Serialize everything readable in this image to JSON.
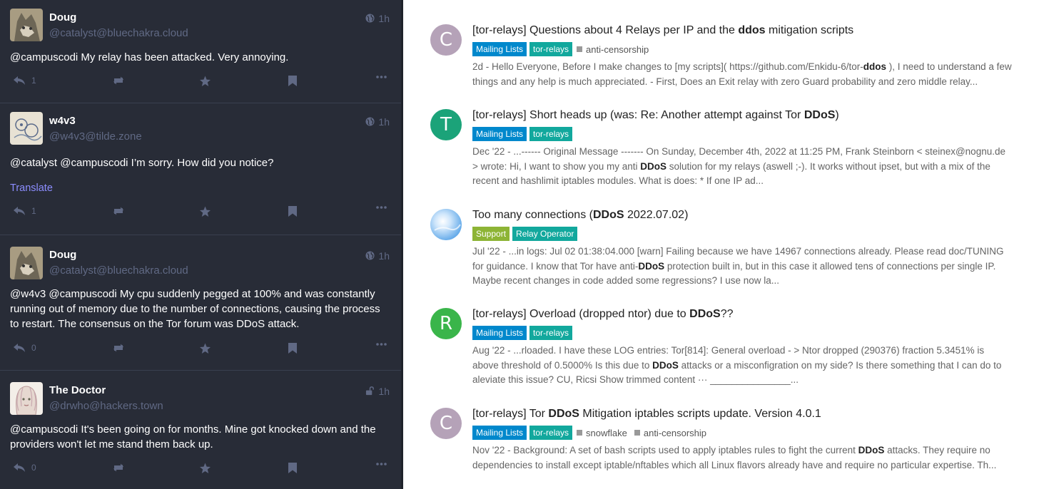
{
  "feed": {
    "posts": [
      {
        "name": "Doug",
        "handle": "@catalyst@bluechakra.cloud",
        "time": "1h",
        "content": "@campuscodi My relay has been attacked. Very annoying.",
        "replies": "1",
        "translate": ""
      },
      {
        "name": "w4v3",
        "handle": "@w4v3@tilde.zone",
        "time": "1h",
        "content": "@catalyst @campuscodi I’m sorry. How did you notice?",
        "replies": "1",
        "translate": "Translate"
      },
      {
        "name": "Doug",
        "handle": "@catalyst@bluechakra.cloud",
        "time": "1h",
        "content": "@w4v3 @campuscodi My cpu suddenly pegged at 100% and was constantly running out of memory due to the number of connections, causing the process to restart. The consensus on the Tor forum was DDoS attack.",
        "replies": "0",
        "translate": ""
      },
      {
        "name": "The Doctor",
        "handle": "@drwho@hackers.town",
        "time": "1h",
        "content": "@campuscodi It's been going on for months. Mine got knocked down and the providers won't let me stand them back up.",
        "replies": "0",
        "translate": ""
      }
    ]
  },
  "results": {
    "topics": [
      {
        "letter": "C",
        "avatar_color": "#b5a2b8",
        "title_pre": "[tor-relays] Questions about 4 Relays per IP and the ",
        "title_bold": "ddos",
        "title_post": " mitigation scripts",
        "badges": [
          {
            "label": "Mailing Lists",
            "color": "#0088cc"
          },
          {
            "label": "tor-relays",
            "color": "#12a89d"
          }
        ],
        "tags": [
          "anti-censorship"
        ],
        "when": "2d",
        "excerpt_a": " - Hello Everyone, Before I make changes to [my scripts]( https://github.com/Enkidu-6/tor-",
        "excerpt_bold": "ddos",
        "excerpt_b": " ), I need to understand a few things and any help is much appreciated. - First, Does an Exit relay with zero Guard probability and zero middle relay..."
      },
      {
        "letter": "T",
        "avatar_color": "#1ba379",
        "title_pre": "[tor-relays] Short heads up (was: Re: Another attempt against Tor ",
        "title_bold": "DDoS",
        "title_post": ")",
        "badges": [
          {
            "label": "Mailing Lists",
            "color": "#0088cc"
          },
          {
            "label": "tor-relays",
            "color": "#12a89d"
          }
        ],
        "tags": [],
        "when": "Dec '22",
        "excerpt_a": " - ...------ Original Message ------- On Sunday, December 4th, 2022 at 11:25 PM, Frank Steinborn < steinex@nognu.de > wrote: Hi, I want to show you my anti ",
        "excerpt_bold": "DDoS",
        "excerpt_b": " solution for my relays (aswell ;-). It works without ipset, but with a mix of the recent and hashlimit iptables modules. What is does: * If one IP ad..."
      },
      {
        "letter": "",
        "avatar_color": "#8fc4ef",
        "title_pre": "Too many connections (",
        "title_bold": "DDoS",
        "title_post": " 2022.07.02)",
        "badges": [
          {
            "label": "Support",
            "color": "#8db435"
          },
          {
            "label": "Relay Operator",
            "color": "#12a89d"
          }
        ],
        "tags": [],
        "when": "Jul '22",
        "excerpt_a": " - ...in logs: Jul 02 01:38:04.000 [warn] Failing because we have 14967 connections already. Please read doc/TUNING for guidance. I know that Tor have anti-",
        "excerpt_bold": "DDoS",
        "excerpt_b": " protection built in, but in this case it allowed tens of connections per single IP. Maybe recent changes in code added some regressions? I use now la..."
      },
      {
        "letter": "R",
        "avatar_color": "#3ab54a",
        "title_pre": "[tor-relays] Overload (dropped ntor) due to ",
        "title_bold": "DDoS",
        "title_post": "??",
        "badges": [
          {
            "label": "Mailing Lists",
            "color": "#0088cc"
          },
          {
            "label": "tor-relays",
            "color": "#12a89d"
          }
        ],
        "tags": [],
        "when": "Aug '22",
        "excerpt_a": " - ...rloaded. I have these LOG entries: Tor[814]: General overload - > Ntor dropped (290376) fraction 5.3451% is above threshold of 0.5000% Is this due to ",
        "excerpt_bold": "DDoS",
        "excerpt_b": " attacks or a misconfigration on my side? Is there something that I can do to aleviate this issue? CU, Ricsi Show trimmed content ··· _______________..."
      },
      {
        "letter": "C",
        "avatar_color": "#b5a2b8",
        "title_pre": "[tor-relays] Tor ",
        "title_bold": "DDoS",
        "title_post": " Mitigation iptables scripts update. Version 4.0.1",
        "badges": [
          {
            "label": "Mailing Lists",
            "color": "#0088cc"
          },
          {
            "label": "tor-relays",
            "color": "#12a89d"
          }
        ],
        "tags": [
          "snowflake",
          "anti-censorship"
        ],
        "when": "Nov '22",
        "excerpt_a": " - Background: A set of bash scripts used to apply iptables rules to fight the current ",
        "excerpt_bold": "DDoS",
        "excerpt_b": " attacks. They require no dependencies to install except iptable/nftables which all Linux flavors already have and require no particular expertise. Th..."
      }
    ]
  }
}
